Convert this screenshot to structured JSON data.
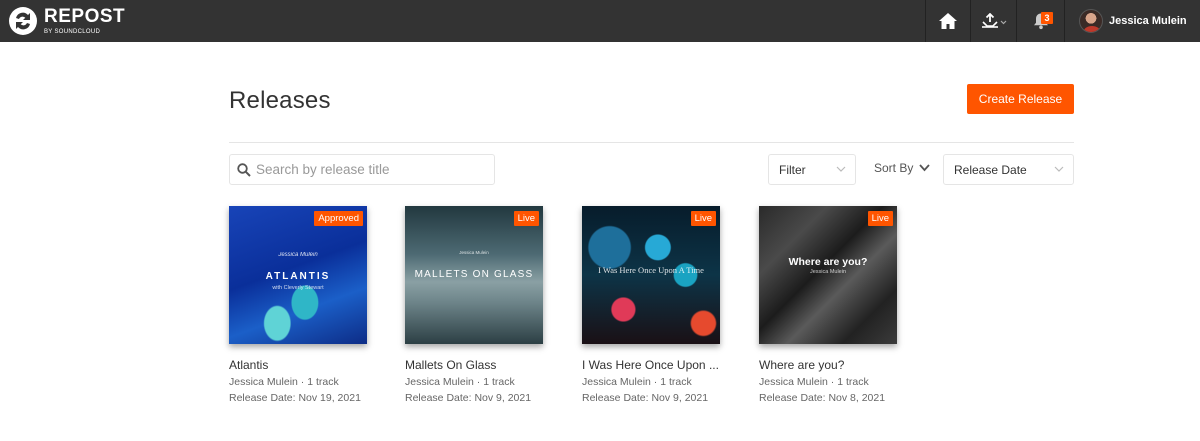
{
  "app": {
    "logo_word": "REPOST",
    "logo_sub": "BY SOUNDCLOUD",
    "accent": "#ff5500",
    "topbar_bg": "#333333"
  },
  "nav": {
    "home_icon": "home-icon",
    "upload_icon": "upload-icon",
    "notifications_icon": "bell-icon",
    "notifications_count": "3",
    "user_name": "Jessica Mulein"
  },
  "header": {
    "title": "Releases",
    "create_label": "Create Release"
  },
  "controls": {
    "search_placeholder": "Search by release title",
    "filter_label": "Filter",
    "sort_by_label": "Sort By",
    "sort_value": "Release Date"
  },
  "releases": [
    {
      "title": "Atlantis",
      "status": "Approved",
      "meta": "Jessica Mulein · 1 track",
      "date": "Release Date: Nov 19, 2021",
      "cover_artist": "Jessica Mulein",
      "cover_title": "ATLANTIS",
      "cover_sub": "with Cleverly Stewart"
    },
    {
      "title": "Mallets On Glass",
      "status": "Live",
      "meta": "Jessica Mulein · 1 track",
      "date": "Release Date: Nov 9, 2021",
      "cover_artist": "Jessica Mulein",
      "cover_title": "MALLETS ON GLASS"
    },
    {
      "title": "I Was Here Once Upon ...",
      "status": "Live",
      "meta": "Jessica Mulein · 1 track",
      "date": "Release Date: Nov 9, 2021",
      "cover_title": "I Was Here Once Upon A Time"
    },
    {
      "title": "Where are you?",
      "status": "Live",
      "meta": "Jessica Mulein · 1 track",
      "date": "Release Date: Nov 8, 2021",
      "cover_title": "Where are you?",
      "cover_artist": "Jessica Mulein"
    }
  ]
}
